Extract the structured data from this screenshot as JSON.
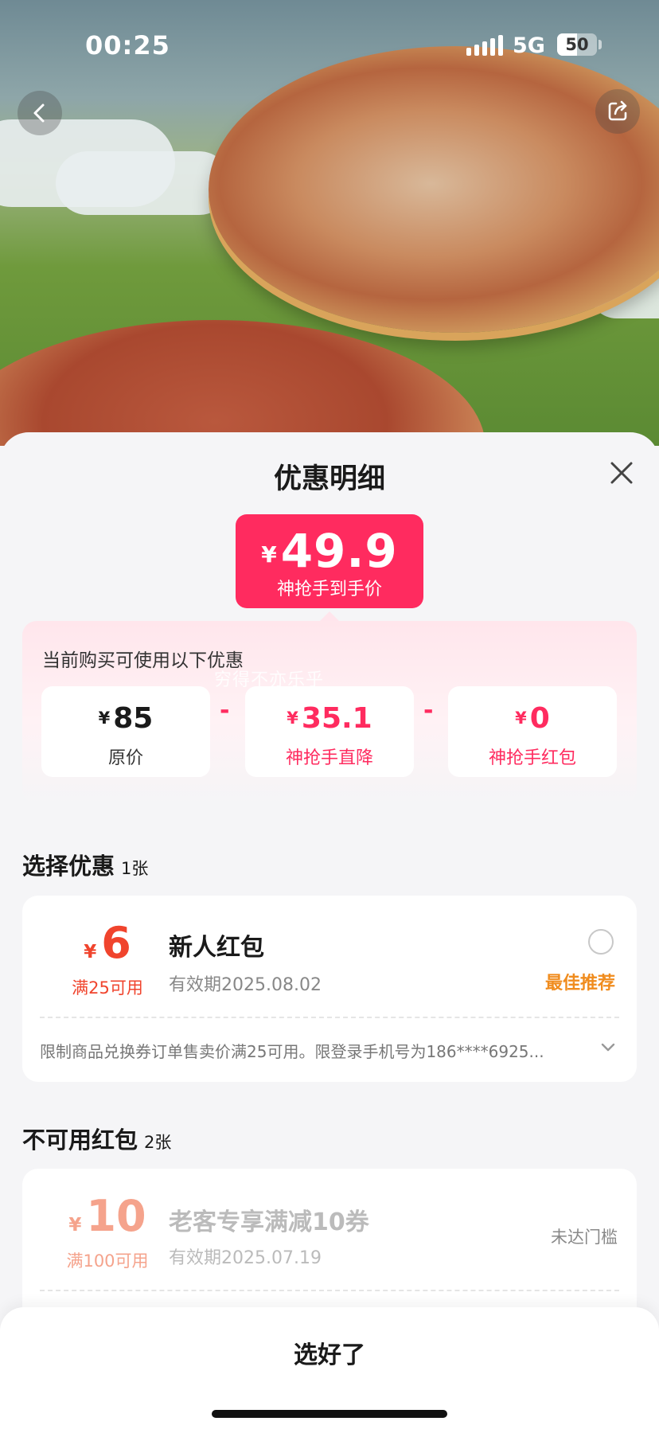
{
  "status_bar": {
    "time": "00:25",
    "network": "5G",
    "battery": "50"
  },
  "sheet": {
    "title": "优惠明细",
    "final_price": {
      "currency": "¥",
      "amount": "49.9",
      "label": "神抢手到手价"
    },
    "breakdown": {
      "title": "当前购买可使用以下优惠",
      "watermark": "穷得不亦乐乎",
      "items": [
        {
          "currency": "¥",
          "value": "85",
          "label": "原价"
        },
        {
          "currency": "¥",
          "value": "35.1",
          "label": "神抢手直降"
        },
        {
          "currency": "¥",
          "value": "0",
          "label": "神抢手红包"
        }
      ],
      "operator": "-"
    },
    "available": {
      "title": "选择优惠",
      "count": "1张",
      "coupons": [
        {
          "currency": "¥",
          "amount": "6",
          "condition": "满25可用",
          "name": "新人红包",
          "expiry": "有效期2025.08.02",
          "tag": "最佳推荐",
          "note": "限制商品兑换券订单售卖价满25可用。限登录手机号为186****6925..."
        }
      ]
    },
    "unavailable": {
      "title": "不可用红包",
      "count": "2张",
      "coupons": [
        {
          "currency": "¥",
          "amount": "10",
          "condition": "满100可用",
          "name": "老客专享满减10券",
          "expiry": "有效期2025.07.19",
          "status": "未达门槛"
        }
      ]
    },
    "confirm_label": "选好了"
  },
  "colors": {
    "accent": "#ff2b5f",
    "coupon_red": "#f0442d",
    "best_orange": "#f08c1e"
  },
  "icons": {
    "back": "chevron-left-icon",
    "share": "share-icon",
    "close": "close-icon",
    "expand": "chevron-down-icon"
  }
}
